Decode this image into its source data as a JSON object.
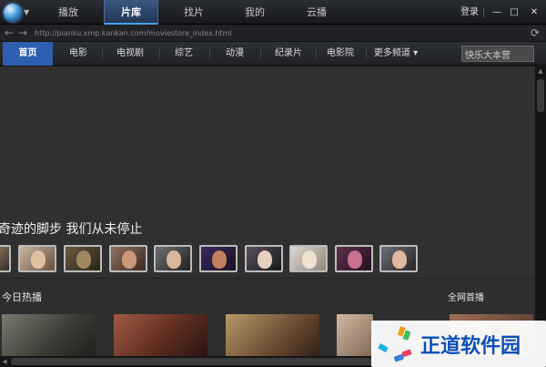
{
  "titlebar": {
    "tabs": [
      {
        "label": "播放",
        "active": false
      },
      {
        "label": "片库",
        "active": true
      },
      {
        "label": "找片",
        "active": false
      },
      {
        "label": "我的",
        "active": false
      },
      {
        "label": "云播",
        "active": false
      }
    ],
    "login_label": "登录",
    "minimize": "—",
    "maximize": "□",
    "close": "✕"
  },
  "addressbar": {
    "back": "←",
    "forward": "→",
    "url": "http://pianku.xmp.kankan.com/moviestore_index.html",
    "refresh": "⟳"
  },
  "catnav": {
    "items": [
      {
        "label": "首页",
        "active": true
      },
      {
        "label": "电影",
        "active": false
      },
      {
        "label": "电视剧",
        "active": false
      },
      {
        "label": "综艺",
        "active": false
      },
      {
        "label": "动漫",
        "active": false
      },
      {
        "label": "纪录片",
        "active": false
      },
      {
        "label": "电影院",
        "active": false
      },
      {
        "label": "更多频道 ▾",
        "active": false
      }
    ],
    "search_value": "快乐大本营"
  },
  "hero": {
    "title": "奇迹的脚步 我们从未停止"
  },
  "sections": {
    "today_hot": "今日热播",
    "net_premiere": "全网首播"
  },
  "scrollbar": {
    "up": "▲",
    "down": "▼",
    "left": "◀",
    "right": "▶"
  },
  "watermark": {
    "text": "正道软件园"
  },
  "colors": {
    "accent": "#2f5fb0",
    "tab_active": "#3a5a84",
    "watermark_text": "#0a4fb8"
  }
}
